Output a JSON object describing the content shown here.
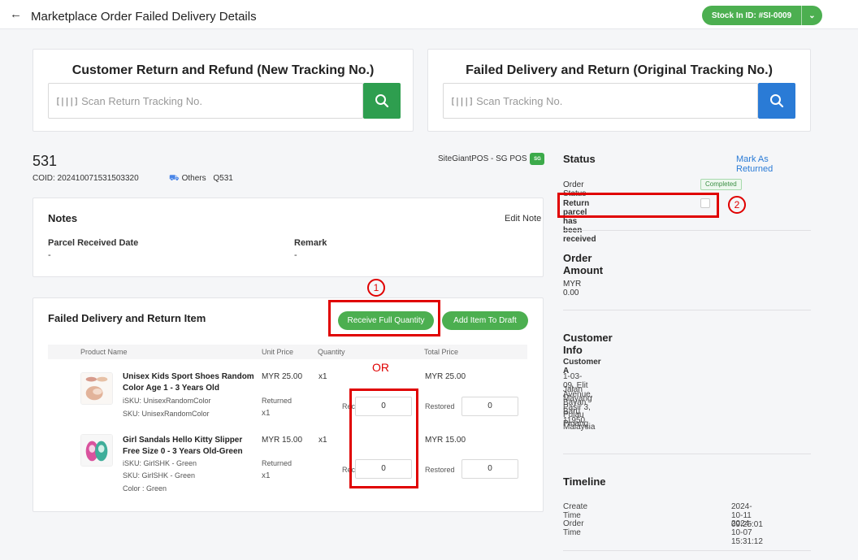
{
  "header": {
    "title": "Marketplace Order Failed Delivery Details",
    "stock_in": "Stock In ID: #SI-0009"
  },
  "scan_customer": {
    "title": "Customer Return and Refund (New Tracking No.)",
    "placeholder": "Scan Return Tracking No.",
    "color": "#2e9e4f"
  },
  "scan_failed": {
    "title": "Failed Delivery and Return (Original Tracking No.)",
    "placeholder": "Scan Tracking No.",
    "color": "#2a7bd6"
  },
  "order": {
    "number": "531",
    "coid": "COID: 202410071531503320",
    "shipping": "Others",
    "search_ref": "Q531",
    "channel": "SiteGiantPOS - SG POS",
    "channel_logo": "SG"
  },
  "notes": {
    "title": "Notes",
    "edit_label": "Edit Note",
    "parcel_label": "Parcel Received Date",
    "parcel_value": "-",
    "remark_label": "Remark",
    "remark_value": "-"
  },
  "items": {
    "title": "Failed Delivery and Return Item",
    "receive_full": "Receive Full Quantity",
    "add_draft": "Add Item To Draft",
    "columns": {
      "product": "Product Name",
      "unit_price": "Unit Price",
      "quantity": "Quantity",
      "total": "Total Price"
    },
    "rows": [
      {
        "name1": "Unisex Kids Sport Shoes Random",
        "name2": "Color Age 1 - 3 Years Old",
        "isku": "iSKU: UnisexRandomColor",
        "sku": "SKU: UnisexRandomColor",
        "color": "",
        "unit_price": "MYR 25.00",
        "qty": "x1",
        "returned_label": "Returned",
        "returned_qty": "x1",
        "received_label": "Received",
        "received": "0",
        "total": "MYR 25.00",
        "restored_label": "Restored",
        "restored": "0"
      },
      {
        "name1": "Girl Sandals Hello Kitty Slipper",
        "name2": "Free Size 0 - 3 Years Old-Green",
        "isku": "iSKU: GirlSHK - Green",
        "sku": "SKU: GirlSHK - Green",
        "color": "Color : Green",
        "unit_price": "MYR 15.00",
        "qty": "x1",
        "returned_label": "Returned",
        "returned_qty": "x1",
        "received_label": "Received",
        "received": "0",
        "total": "MYR 15.00",
        "restored_label": "Restored",
        "restored": "0"
      }
    ]
  },
  "status": {
    "title": "Status",
    "mark_returned": "Mark As Returned",
    "order_status_label": "Order Status",
    "order_status": "Completed",
    "parcel_received_label": "Return parcel has been received"
  },
  "amount": {
    "title": "Order Amount",
    "value": "MYR 0.00"
  },
  "customer": {
    "title": "Customer Info",
    "name": "Customer A",
    "address": [
      "1-03-09, Elit Avenue,",
      "Jalan Mayang Pasir 3,",
      "Bayan Baru 11950",
      "Pulau Pinang",
      "Malaysia"
    ]
  },
  "timeline": {
    "title": "Timeline",
    "create_label": "Create Time",
    "create_value": "2024-10-11 09:25:01",
    "order_label": "Order Time",
    "order_value": "2024-10-07 15:31:12"
  },
  "annotations": {
    "step1": "1",
    "step2": "2",
    "or_label": "OR",
    "color": "#e00000"
  }
}
